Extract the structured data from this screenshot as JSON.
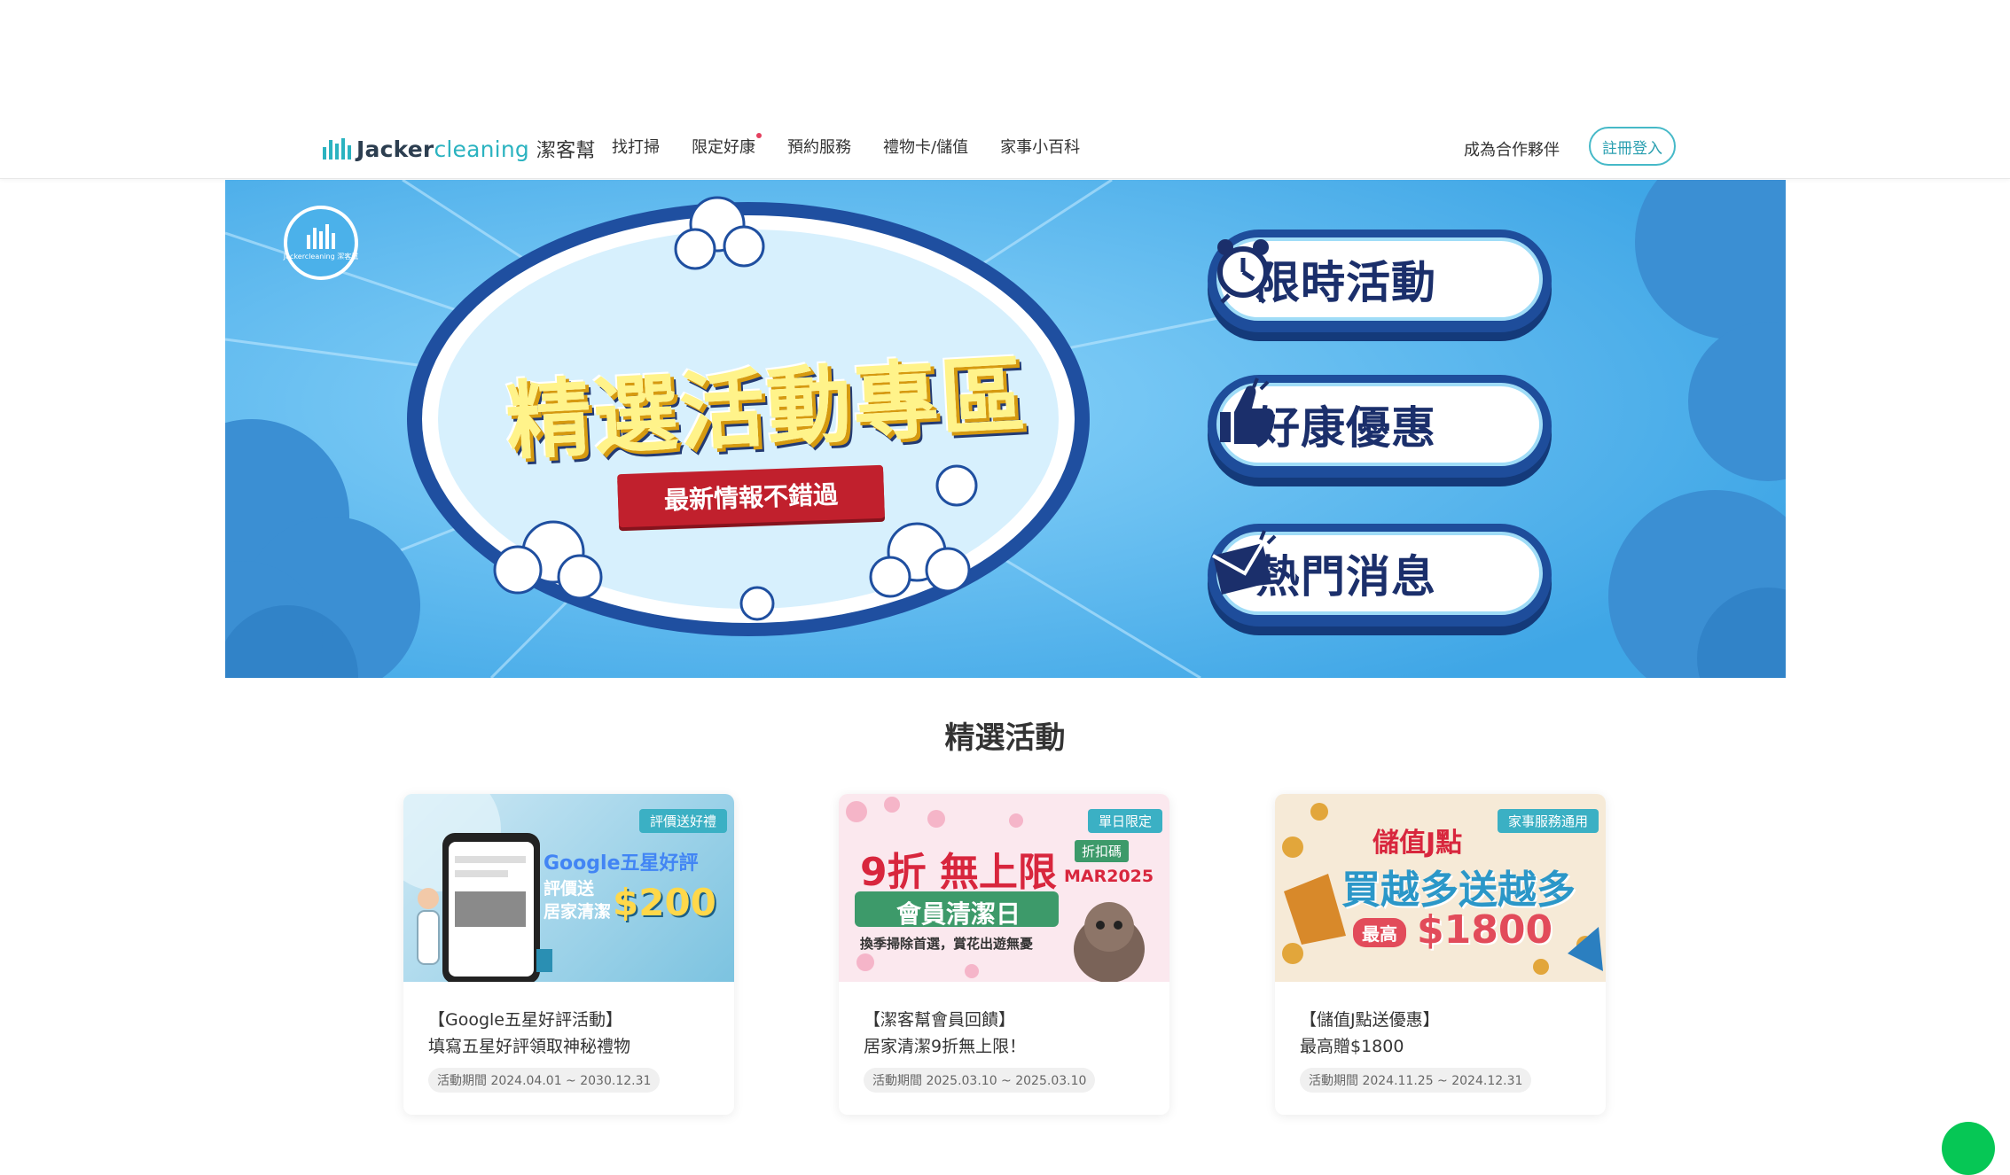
{
  "header": {
    "logo": {
      "brand_bold": "Jacker",
      "brand_light": "cleaning",
      "brand_cn": "潔客幫"
    },
    "nav": [
      {
        "label": "找打掃"
      },
      {
        "label": "限定好康",
        "has_dot": true
      },
      {
        "label": "預約服務"
      },
      {
        "label": "禮物卡/儲值"
      },
      {
        "label": "家事小百科"
      }
    ],
    "partner_link": "成為合作夥伴",
    "login_button": "註冊登入"
  },
  "banner": {
    "badge_text": "Jackercleaning 潔客幫",
    "title": "精選活動專區",
    "ribbon": "最新情報不錯過",
    "buttons": [
      {
        "label": "限時活動",
        "icon": "alarm-clock-icon"
      },
      {
        "label": "好康優惠",
        "icon": "thumbs-up-icon"
      },
      {
        "label": "熱門消息",
        "icon": "envelope-icon"
      }
    ]
  },
  "section": {
    "title": "精選活動"
  },
  "cards": [
    {
      "tag": "評價送好禮",
      "img_text1": "Google五星好評",
      "img_text2": "評價送",
      "img_text3": "居家清潔",
      "img_amount": "$200",
      "title1": "【Google五星好評活動】",
      "title2": "填寫五星好評領取神秘禮物",
      "period": "活動期間 2024.04.01 ~ 2030.12.31"
    },
    {
      "tag": "單日限定",
      "img_text1": "9折 無上限",
      "img_text2": "會員清潔日",
      "img_text3": "換季掃除首選，賞花出遊無憂",
      "img_badge": "折扣碼",
      "img_code": "MAR2025",
      "title1": "【潔客幫會員回饋】",
      "title2": "居家清潔9折無上限！",
      "period": "活動期間 2025.03.10 ~ 2025.03.10"
    },
    {
      "tag": "家事服務通用",
      "img_text1": "儲值J點",
      "img_text2": "買越多送越多",
      "img_text3": "最高",
      "img_amount": "$1800",
      "title1": "【儲值J點送優惠】",
      "title2": "最高贈$1800",
      "period": "活動期間 2024.11.25 ~ 2024.12.31"
    }
  ],
  "colors": {
    "accent": "#2bb3c0",
    "banner_bg": "#47b0ea",
    "navy": "#1b2f6b",
    "ribbon_red": "#c1202d",
    "line_green": "#06c755"
  }
}
